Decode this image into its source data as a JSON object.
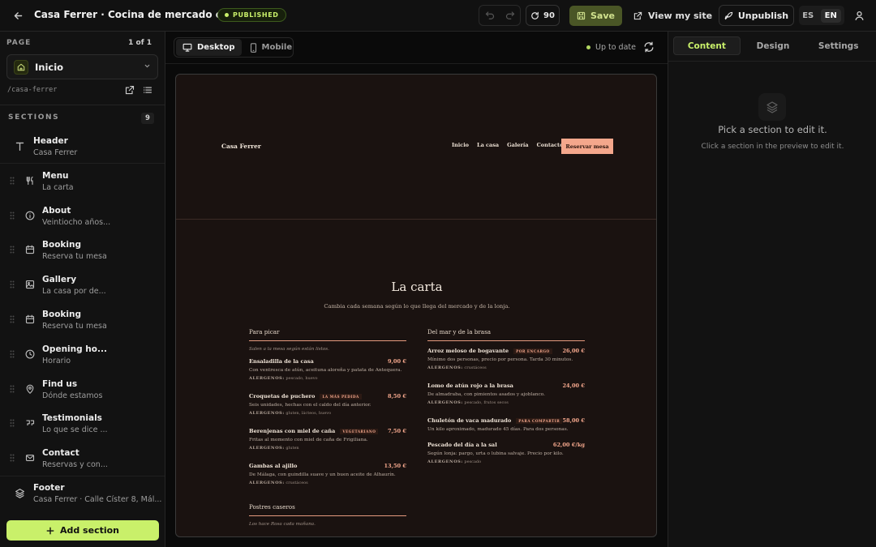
{
  "topbar": {
    "site_title": "Casa Ferrer · Cocina de mercado en...",
    "status_badge": "PUBLISHED",
    "credits": "90",
    "save_label": "Save",
    "view_site_label": "View my site",
    "unpublish_label": "Unpublish",
    "languages": [
      "ES",
      "EN"
    ],
    "active_language": "EN"
  },
  "sidebar": {
    "page_label": "PAGE",
    "page_count": "1 of 1",
    "current_page": "Inicio",
    "slug": "/casa-ferrer",
    "sections_label": "SECTIONS",
    "sections_count": "9",
    "sections": [
      {
        "title": "Header",
        "subtitle": "Casa Ferrer",
        "icon": "text-icon"
      },
      {
        "title": "Menu",
        "subtitle": "La carta",
        "icon": "utensils-icon"
      },
      {
        "title": "About",
        "subtitle": "Veintiocho años...",
        "icon": "info-icon"
      },
      {
        "title": "Booking",
        "subtitle": "Reserva tu mesa",
        "icon": "calendar-icon"
      },
      {
        "title": "Gallery",
        "subtitle": "La casa por de...",
        "icon": "image-icon"
      },
      {
        "title": "Booking",
        "subtitle": "Reserva tu mesa",
        "icon": "calendar-icon"
      },
      {
        "title": "Opening ho...",
        "subtitle": "Horario",
        "icon": "clock-icon"
      },
      {
        "title": "Find us",
        "subtitle": "Dónde estamos",
        "icon": "map-pin-icon"
      },
      {
        "title": "Testimonials",
        "subtitle": "Lo que se dice ...",
        "icon": "quote-icon"
      },
      {
        "title": "Contact",
        "subtitle": "Reservas y con...",
        "icon": "mail-icon"
      },
      {
        "title": "Footer",
        "subtitle": "Casa Ferrer · Calle Císter 8, Mál...",
        "icon": "layers-icon"
      }
    ],
    "add_section_label": "Add section"
  },
  "canvas": {
    "devices": [
      "Desktop",
      "Mobile"
    ],
    "active_device": "Desktop",
    "sync_status": "Up to date"
  },
  "preview": {
    "brand": "Casa Ferrer",
    "nav": [
      "Inicio",
      "La casa",
      "Galería",
      "Contacto"
    ],
    "cta": "Reservar mesa",
    "menu_title": "La carta",
    "menu_lead": "Cambia cada semana según lo que llega del mercado y de la lonja.",
    "allergen_label": "ALERGENOS:",
    "columns": [
      {
        "heading": "Para picar",
        "note": "Salen a la mesa según están listos.",
        "dishes": [
          {
            "name": "Ensaladilla de la casa",
            "tag": "",
            "price": "9,00 €",
            "desc": "Con ventresca de atún, aceituna aloreña y patata de Antequera.",
            "allergens": "pescado, huevo"
          },
          {
            "name": "Croquetas de puchero",
            "tag": "LA MÁS PEDIDA",
            "price": "8,50 €",
            "desc": "Seis unidades, hechas con el caldo del día anterior.",
            "allergens": "gluten, lácteos, huevo"
          },
          {
            "name": "Berenjenas con miel de caña",
            "tag": "VEGETARIANO",
            "price": "7,50 €",
            "desc": "Fritas al momento con miel de caña de Frigiliana.",
            "allergens": "gluten"
          },
          {
            "name": "Gambas al ajillo",
            "tag": "",
            "price": "13,50 €",
            "desc": "De Málaga, con guindilla suave y un buen aceite de Alhaurín.",
            "allergens": "crustáceos"
          }
        ],
        "next_heading": "Postres caseros",
        "next_note": "Los hace Rosa cada mañana."
      },
      {
        "heading": "Del mar y de la brasa",
        "note": "",
        "dishes": [
          {
            "name": "Arroz meloso de bogavante",
            "tag": "POR ENCARGO",
            "price": "26,00 €",
            "desc": "Mínimo dos personas, precio por persona. Tarda 30 minutos.",
            "allergens": "crustáceos"
          },
          {
            "name": "Lomo de atún rojo a la brasa",
            "tag": "",
            "price": "24,00 €",
            "desc": "De almadraba, con pimientos asados y ajoblanco.",
            "allergens": "pescado, frutos secos"
          },
          {
            "name": "Chuletón de vaca madurado",
            "tag": "PARA COMPARTIR",
            "price": "58,00 €",
            "desc": "Un kilo aproximado, madurado 45 días. Para dos personas.",
            "allergens": ""
          },
          {
            "name": "Pescado del día a la sal",
            "tag": "",
            "price": "62,00 €/kg",
            "desc": "Según lonja: pargo, urta o lubina salvaje. Precio por kilo.",
            "allergens": "pescado"
          }
        ]
      }
    ]
  },
  "inspector": {
    "tabs": [
      "Content",
      "Design",
      "Settings"
    ],
    "active_tab": "Content",
    "empty_title": "Pick a section to edit it.",
    "empty_subtitle": "Click a section in the preview to edit it."
  },
  "colors": {
    "accent": "#c9f06a",
    "preview_bg": "#1a1210",
    "preview_accent": "#f4a78c"
  }
}
